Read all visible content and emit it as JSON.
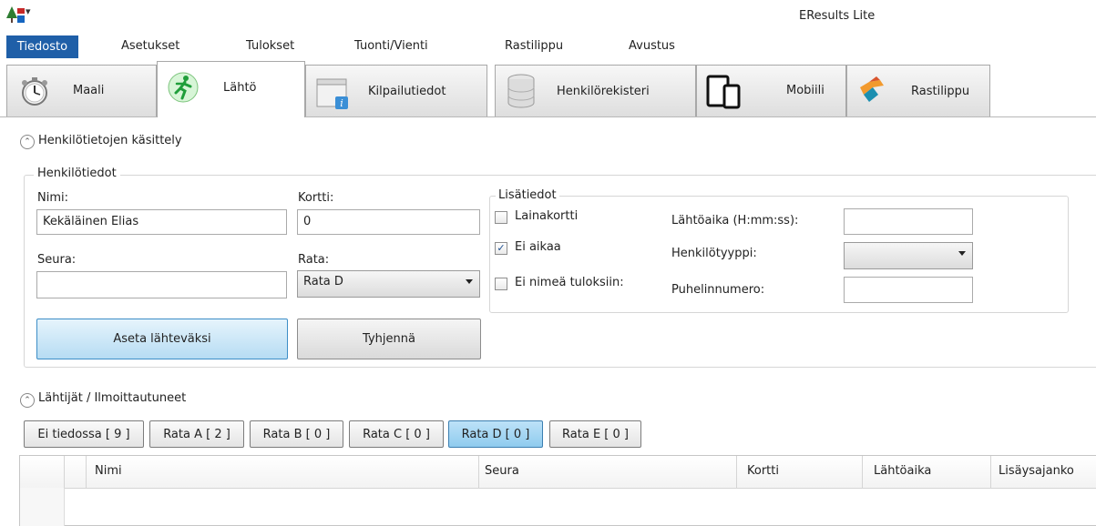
{
  "window": {
    "title": "EResults Lite"
  },
  "menu": [
    "Tiedosto",
    "Asetukset",
    "Tulokset",
    "Tuonti/Vienti",
    "Rastilippu",
    "Avustus"
  ],
  "tabs": [
    {
      "label": "Maali",
      "icon": "stopwatch-icon"
    },
    {
      "label": "Lähtö",
      "icon": "running-man-icon"
    },
    {
      "label": "Kilpailutiedot",
      "icon": "info-window-icon"
    },
    {
      "label": "Henkilörekisteri",
      "icon": "database-icon"
    },
    {
      "label": "Mobiili",
      "icon": "mobile-devices-icon"
    },
    {
      "label": "Rastilippu",
      "icon": "flag-icon"
    }
  ],
  "person_section": {
    "title": "Henkilötietojen käsittely",
    "group_title": "Henkilötiedot",
    "name_label": "Nimi:",
    "name_value": "Kekäläinen Elias",
    "card_label": "Kortti:",
    "card_value": "0",
    "club_label": "Seura:",
    "club_value": "",
    "course_label": "Rata:",
    "course_value": "Rata D",
    "extra": {
      "title": "Lisätiedot",
      "rental_card_label": "Lainakortti",
      "rental_card_checked": false,
      "no_time_label": "Ei aikaa",
      "no_time_checked": true,
      "no_name_label": "Ei nimeä tuloksiin:",
      "no_name_checked": false,
      "start_time_label": "Lähtöaika (H:mm:ss):",
      "start_time_value": "",
      "person_type_label": "Henkilötyyppi:",
      "person_type_value": "",
      "phone_label": "Puhelinnumero:",
      "phone_value": ""
    },
    "set_start_button": "Aseta lähteväksi",
    "clear_button": "Tyhjennä"
  },
  "starters_section": {
    "title": "Lähtijät / Ilmoittautuneet",
    "filters": [
      {
        "label": "Ei tiedossa [ 9 ]",
        "selected": false
      },
      {
        "label": "Rata A [ 2 ]",
        "selected": false
      },
      {
        "label": "Rata B [ 0 ]",
        "selected": false
      },
      {
        "label": "Rata C [ 0 ]",
        "selected": false
      },
      {
        "label": "Rata D [ 0 ]",
        "selected": true
      },
      {
        "label": "Rata E [ 0 ]",
        "selected": false
      }
    ],
    "columns": [
      "Nimi",
      "Seura",
      "Kortti",
      "Lähtöaika",
      "Lisäysajanko"
    ]
  },
  "colors": {
    "accent": "#1f5fa8",
    "selected_filter": "#9fd3f1",
    "primary_button": "#b6dcf3"
  }
}
